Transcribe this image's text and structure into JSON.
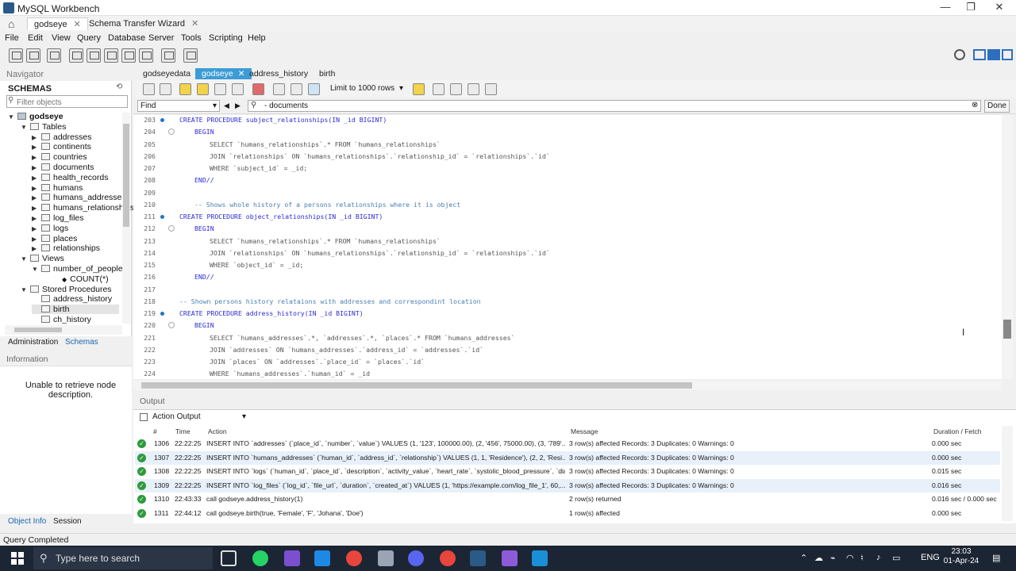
{
  "window": {
    "title": "MySQL Workbench",
    "minimize": "—",
    "maximize": "❐",
    "close": "✕"
  },
  "tabs": [
    {
      "label": "godseye"
    },
    {
      "label": "Schema Transfer Wizard"
    }
  ],
  "menu": [
    "File",
    "Edit",
    "View",
    "Query",
    "Database",
    "Server",
    "Tools",
    "Scripting",
    "Help"
  ],
  "navigator": {
    "header": "Navigator",
    "schemas_label": "SCHEMAS",
    "filter_placeholder": "Filter objects",
    "schema": "godseye",
    "tables_label": "Tables",
    "tables": [
      "addresses",
      "continents",
      "countries",
      "documents",
      "health_records",
      "humans",
      "humans_addresses",
      "humans_relationships",
      "log_files",
      "logs",
      "places",
      "relationships"
    ],
    "views_label": "Views",
    "view": "number_of_people",
    "view_column": "COUNT(*)",
    "procs_label": "Stored Procedures",
    "procs": [
      "address_history",
      "birth",
      "ch_history"
    ],
    "subtabs": [
      "Administration",
      "Schemas"
    ],
    "info_header": "Information",
    "info_text": "Unable to retrieve node description.",
    "bottom_tabs": [
      "Object Info",
      "Session"
    ]
  },
  "editor": {
    "tabs": [
      "godseyedata",
      "godseye",
      "address_history",
      "birth"
    ],
    "limit": "Limit to 1000 rows",
    "find_mode": "Find",
    "find_value": "- documents",
    "done_label": "Done",
    "lines": [
      {
        "n": "203",
        "dot": true,
        "fold": false,
        "indent": 0,
        "type": "kw",
        "text": "CREATE PROCEDURE subject_relationships(IN _id BIGINT)"
      },
      {
        "n": "204",
        "dot": false,
        "fold": true,
        "indent": 1,
        "type": "kw",
        "text": "BEGIN"
      },
      {
        "n": "205",
        "dot": false,
        "fold": false,
        "indent": 2,
        "type": "mix",
        "text": "SELECT `humans_relationships`.* FROM `humans_relationships`"
      },
      {
        "n": "206",
        "dot": false,
        "fold": false,
        "indent": 2,
        "type": "mix",
        "text": "JOIN `relationships` ON `humans_relationships`.`relationship_id` = `relationships`.`id`"
      },
      {
        "n": "207",
        "dot": false,
        "fold": false,
        "indent": 2,
        "type": "mix",
        "text": "WHERE `subject_id` = _id;"
      },
      {
        "n": "208",
        "dot": false,
        "fold": false,
        "indent": 1,
        "type": "kw",
        "text": "END//"
      },
      {
        "n": "209",
        "dot": false,
        "fold": false,
        "indent": 0,
        "type": "plain",
        "text": ""
      },
      {
        "n": "210",
        "dot": false,
        "fold": false,
        "indent": 1,
        "type": "cm",
        "text": "-- Shows whole history of a persons relationships where it is object"
      },
      {
        "n": "211",
        "dot": true,
        "fold": false,
        "indent": 0,
        "type": "kw",
        "text": "CREATE PROCEDURE object_relationships(IN _id BIGINT)"
      },
      {
        "n": "212",
        "dot": false,
        "fold": true,
        "indent": 1,
        "type": "kw",
        "text": "BEGIN"
      },
      {
        "n": "213",
        "dot": false,
        "fold": false,
        "indent": 2,
        "type": "mix",
        "text": "SELECT `humans_relationships`.* FROM `humans_relationships`"
      },
      {
        "n": "214",
        "dot": false,
        "fold": false,
        "indent": 2,
        "type": "mix",
        "text": "JOIN `relationships` ON `humans_relationships`.`relationship_id` = `relationships`.`id`"
      },
      {
        "n": "215",
        "dot": false,
        "fold": false,
        "indent": 2,
        "type": "mix",
        "text": "WHERE `object_id` = _id;"
      },
      {
        "n": "216",
        "dot": false,
        "fold": false,
        "indent": 1,
        "type": "kw",
        "text": "END//"
      },
      {
        "n": "217",
        "dot": false,
        "fold": false,
        "indent": 0,
        "type": "plain",
        "text": ""
      },
      {
        "n": "218",
        "dot": false,
        "fold": false,
        "indent": 0,
        "type": "cm",
        "text": "-- Shown persons history relataions with addresses and correspondint location"
      },
      {
        "n": "219",
        "dot": true,
        "fold": false,
        "indent": 0,
        "type": "kw",
        "text": "CREATE PROCEDURE address_history(IN _id BIGINT)"
      },
      {
        "n": "220",
        "dot": false,
        "fold": true,
        "indent": 1,
        "type": "kw",
        "text": "BEGIN"
      },
      {
        "n": "221",
        "dot": false,
        "fold": false,
        "indent": 2,
        "type": "mix",
        "text": "SELECT `humans_addresses`.*, `addresses`.*, `places`.* FROM `humans_addresses`"
      },
      {
        "n": "222",
        "dot": false,
        "fold": false,
        "indent": 2,
        "type": "mix",
        "text": "JOIN `addresses` ON `humans_addresses`.`address_id` = `addresses`.`id`"
      },
      {
        "n": "223",
        "dot": false,
        "fold": false,
        "indent": 2,
        "type": "mix",
        "text": "JOIN `places` ON `addresses`.`place_id` = `places`.`id`"
      },
      {
        "n": "224",
        "dot": false,
        "fold": false,
        "indent": 2,
        "type": "mix",
        "text": "WHERE `humans_addresses`.`human_id` = _id"
      }
    ]
  },
  "output": {
    "header": "Output",
    "selector": "Action Output",
    "columns": [
      "#",
      "Time",
      "Action",
      "Message",
      "Duration / Fetch"
    ],
    "rows": [
      {
        "num": "1306",
        "time": "22:22:25",
        "action": "INSERT INTO `addresses` (`place_id`, `number`, `value`) VALUES  (1, '123', 100000.00), (2, '456', 75000.00), (3, '789'...",
        "message": "3 row(s) affected Records: 3  Duplicates: 0  Warnings: 0",
        "duration": "0.000 sec"
      },
      {
        "num": "1307",
        "time": "22:22:25",
        "action": "INSERT INTO `humans_addresses` (`human_id`, `address_id`, `relationship`) VALUES  (1, 1, 'Residence'), (2, 2, 'Resi...",
        "message": "3 row(s) affected Records: 3  Duplicates: 0  Warnings: 0",
        "duration": "0.000 sec"
      },
      {
        "num": "1308",
        "time": "22:22:25",
        "action": "INSERT INTO `logs` (`human_id`, `place_id`, `description`, `activity_value`, `heart_rate`, `systolic_blood_pressure`, `dia...",
        "message": "3 row(s) affected Records: 3  Duplicates: 0  Warnings: 0",
        "duration": "0.015 sec"
      },
      {
        "num": "1309",
        "time": "22:22:25",
        "action": "INSERT INTO `log_files` (`log_id`, `file_url`, `duration`, `created_at`) VALUES  (1, 'https://example.com/log_file_1', 60,...",
        "message": "3 row(s) affected Records: 3  Duplicates: 0  Warnings: 0",
        "duration": "0.016 sec"
      },
      {
        "num": "1310",
        "time": "22:43:33",
        "action": "call godseye.address_history(1)",
        "message": "2 row(s) returned",
        "duration": "0.016 sec / 0.000 sec"
      },
      {
        "num": "1311",
        "time": "22:44:12",
        "action": "call godseye.birth(true, 'Female', 'F', 'Johana', 'Doe')",
        "message": "1 row(s) affected",
        "duration": "0.000 sec"
      }
    ]
  },
  "status": "Query Completed",
  "taskbar": {
    "search_placeholder": "Type here to search",
    "lang": "ENG",
    "time": "23:03",
    "date": "01-Apr-24"
  }
}
